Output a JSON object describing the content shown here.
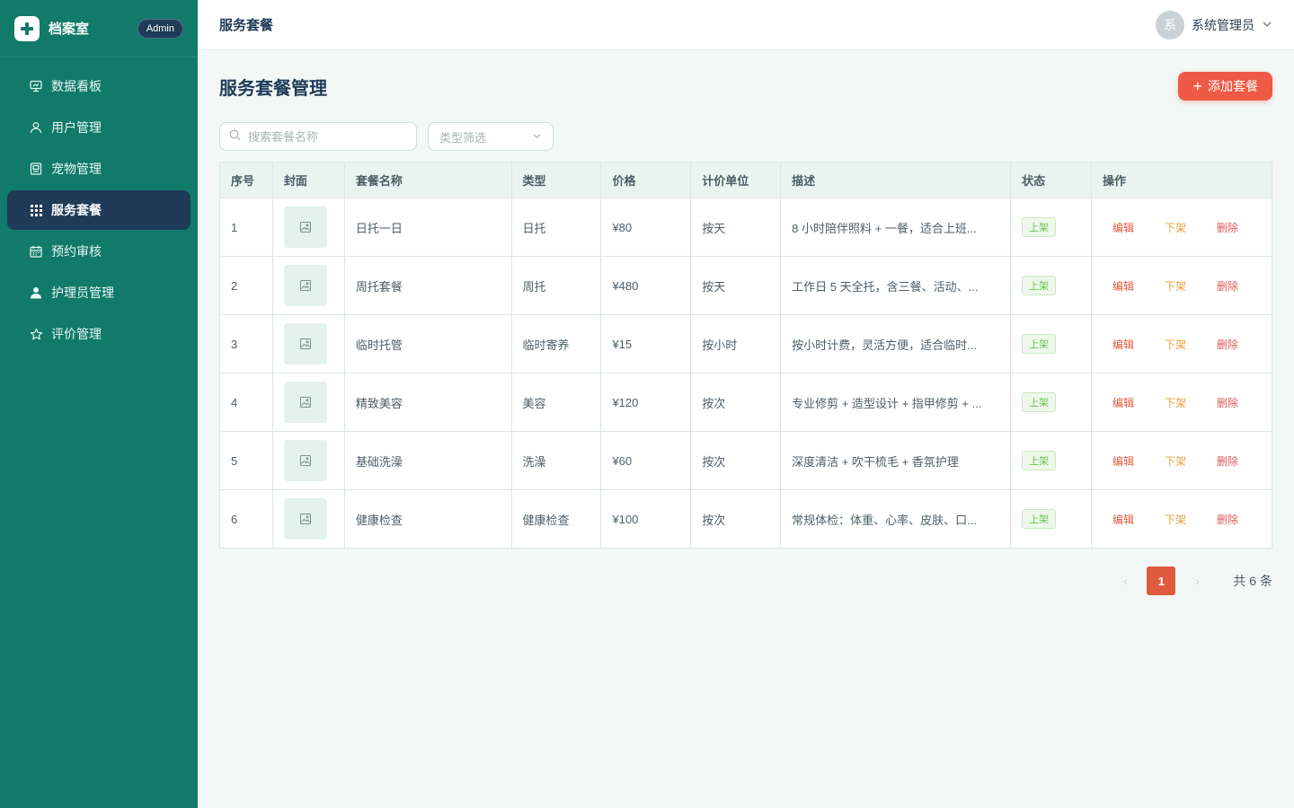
{
  "brand": {
    "title": "档案室",
    "badge": "Admin"
  },
  "sidebar": {
    "items": [
      {
        "label": "数据看板",
        "icon": "dashboard-icon",
        "active": false
      },
      {
        "label": "用户管理",
        "icon": "user-icon",
        "active": false
      },
      {
        "label": "宠物管理",
        "icon": "pet-card-icon",
        "active": false
      },
      {
        "label": "服务套餐",
        "icon": "grid-icon",
        "active": true
      },
      {
        "label": "预约审核",
        "icon": "calendar-icon",
        "active": false
      },
      {
        "label": "护理员管理",
        "icon": "person-solid-icon",
        "active": false
      },
      {
        "label": "评价管理",
        "icon": "star-icon",
        "active": false
      }
    ]
  },
  "header": {
    "title": "服务套餐",
    "user_avatar": "系",
    "user_name": "系统管理员"
  },
  "main": {
    "title": "服务套餐管理",
    "add_button": "添加套餐",
    "search": {
      "placeholder": "搜索套餐名称"
    },
    "type_filter": {
      "placeholder": "类型筛选"
    }
  },
  "table": {
    "columns": [
      "序号",
      "封面",
      "套餐名称",
      "类型",
      "价格",
      "计价单位",
      "描述",
      "状态",
      "操作"
    ],
    "actions": {
      "edit": "编辑",
      "off_shelf": "下架",
      "delete": "删除"
    },
    "rows": [
      {
        "no": "1",
        "name": "日托一日",
        "type": "日托",
        "price": "¥80",
        "unit": "按天",
        "desc": "8 小时陪伴照料 + 一餐，适合上班...",
        "status": "上架"
      },
      {
        "no": "2",
        "name": "周托套餐",
        "type": "周托",
        "price": "¥480",
        "unit": "按天",
        "desc": "工作日 5 天全托，含三餐、活动、...",
        "status": "上架"
      },
      {
        "no": "3",
        "name": "临时托管",
        "type": "临时寄养",
        "price": "¥15",
        "unit": "按小时",
        "desc": "按小时计费，灵活方便，适合临时...",
        "status": "上架"
      },
      {
        "no": "4",
        "name": "精致美容",
        "type": "美容",
        "price": "¥120",
        "unit": "按次",
        "desc": "专业修剪 + 造型设计 + 指甲修剪 + ...",
        "status": "上架"
      },
      {
        "no": "5",
        "name": "基础洗澡",
        "type": "洗澡",
        "price": "¥60",
        "unit": "按次",
        "desc": "深度清洁 + 吹干梳毛 + 香氛护理",
        "status": "上架"
      },
      {
        "no": "6",
        "name": "健康检查",
        "type": "健康检查",
        "price": "¥100",
        "unit": "按次",
        "desc": "常规体检：体重、心率、皮肤、口...",
        "status": "上架"
      }
    ]
  },
  "pagination": {
    "current": "1",
    "total": "共 6 条"
  },
  "colors": {
    "sidebar": "#117a6b",
    "active_nav": "#1f3b57",
    "accent": "#ee5a45"
  }
}
